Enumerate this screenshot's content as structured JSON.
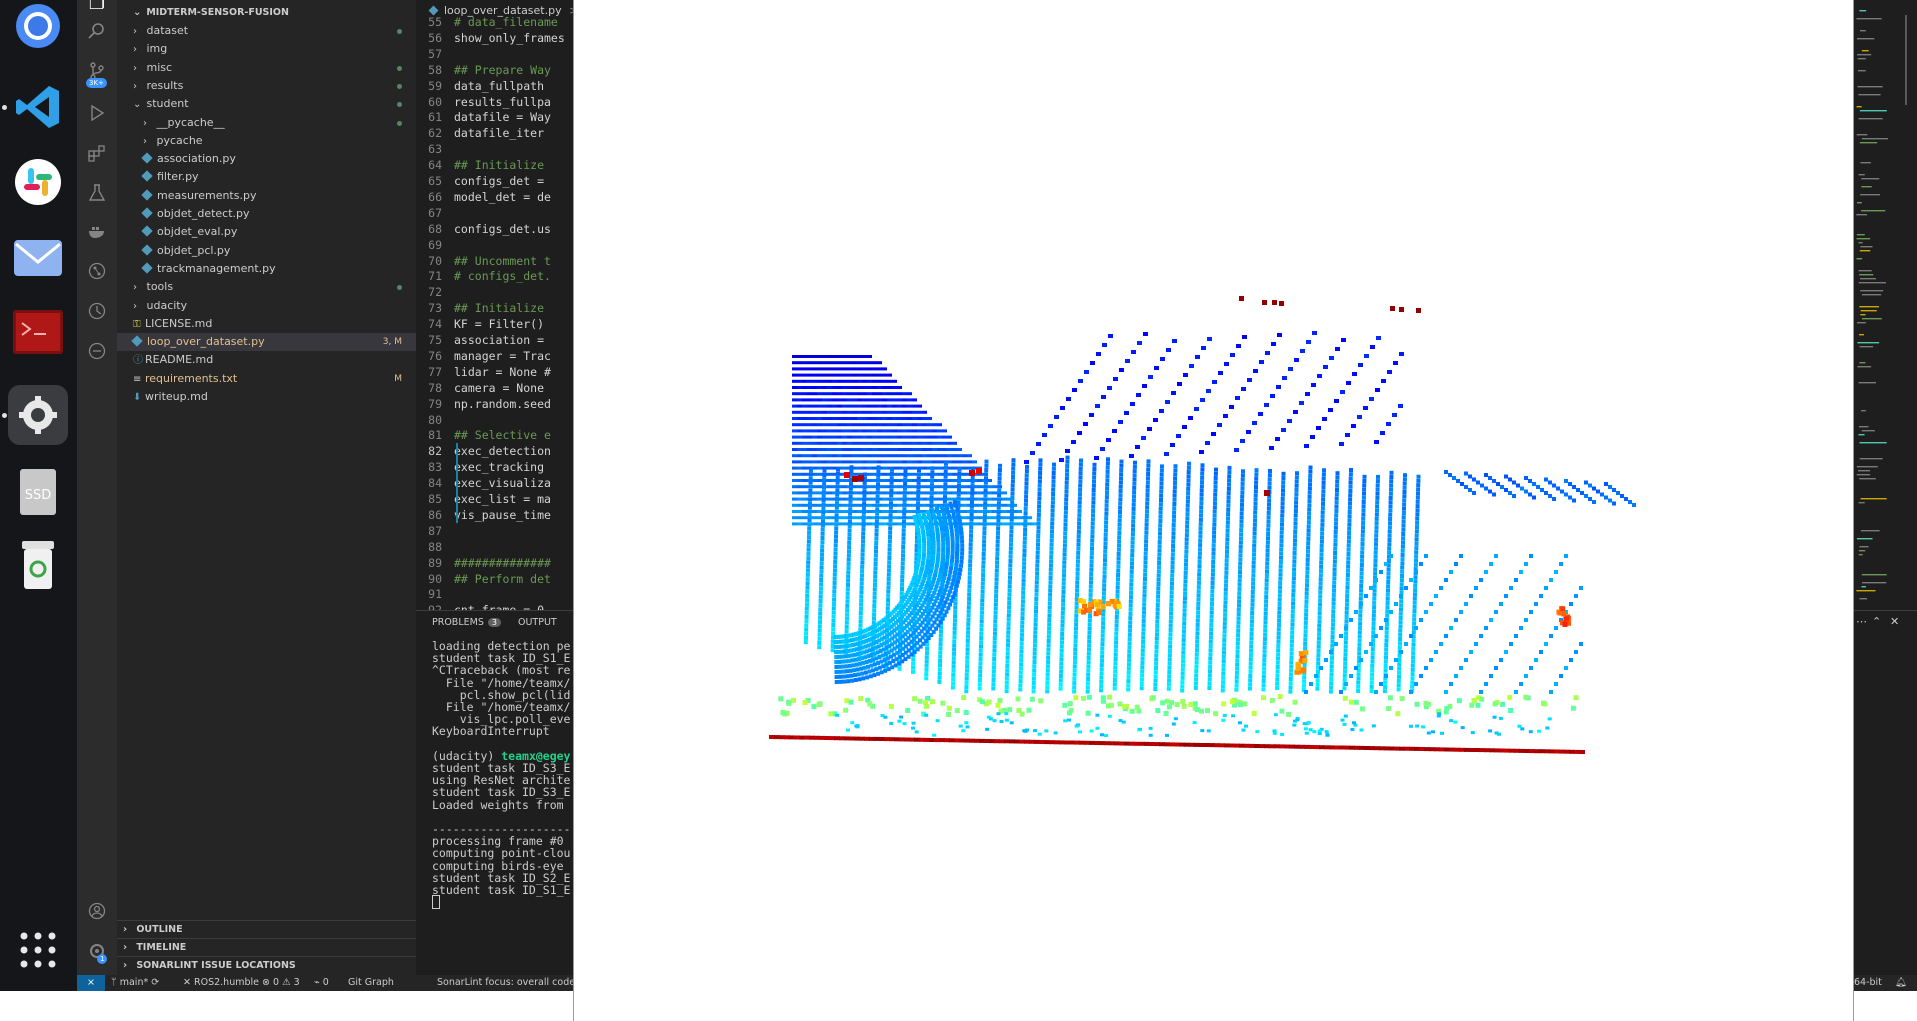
{
  "colors": {
    "dock_bg": "#15161a",
    "activity_bg": "#2c2c2c",
    "explorer_bg": "#252526",
    "editor_bg": "#1e1e1e",
    "accent": "#0e639c",
    "modified": "#e2c08d"
  },
  "dock": {
    "apps": [
      {
        "name": "chromium",
        "icon": "chromium-icon"
      },
      {
        "name": "vscode",
        "icon": "vscode-icon"
      },
      {
        "name": "slack",
        "icon": "slack-icon"
      },
      {
        "name": "mail",
        "icon": "mail-icon"
      },
      {
        "name": "terminal-app",
        "icon": "terminal-icon"
      },
      {
        "name": "settings",
        "icon": "gear-icon"
      },
      {
        "name": "disk",
        "icon": "ssd-icon",
        "label": "SSD"
      },
      {
        "name": "trash",
        "icon": "trash-icon"
      },
      {
        "name": "app-grid",
        "icon": "grid-icon"
      }
    ]
  },
  "activity_bar": {
    "scm_badge": "3K+",
    "accounts_badge": "1"
  },
  "explorer": {
    "root": "MIDTERM-SENSOR-FUSION",
    "items": [
      {
        "label": "dataset",
        "type": "folder",
        "depth": 1,
        "expanded": false,
        "modified": true
      },
      {
        "label": "img",
        "type": "folder",
        "depth": 1,
        "expanded": false,
        "modified": false
      },
      {
        "label": "misc",
        "type": "folder",
        "depth": 1,
        "expanded": false,
        "modified": true
      },
      {
        "label": "results",
        "type": "folder",
        "depth": 1,
        "expanded": false,
        "modified": true
      },
      {
        "label": "student",
        "type": "folder",
        "depth": 1,
        "expanded": true,
        "modified": true
      },
      {
        "label": "__pycache__",
        "type": "folder",
        "depth": 2,
        "expanded": false,
        "modified": true
      },
      {
        "label": "pycache",
        "type": "folder",
        "depth": 2,
        "expanded": false,
        "modified": false
      },
      {
        "label": "association.py",
        "type": "py",
        "depth": 2
      },
      {
        "label": "filter.py",
        "type": "py",
        "depth": 2
      },
      {
        "label": "measurements.py",
        "type": "py",
        "depth": 2
      },
      {
        "label": "objdet_detect.py",
        "type": "py",
        "depth": 2
      },
      {
        "label": "objdet_eval.py",
        "type": "py",
        "depth": 2
      },
      {
        "label": "objdet_pcl.py",
        "type": "py",
        "depth": 2
      },
      {
        "label": "trackmanagement.py",
        "type": "py",
        "depth": 2
      },
      {
        "label": "tools",
        "type": "folder",
        "depth": 1,
        "expanded": false,
        "modified": true
      },
      {
        "label": "udacity",
        "type": "folder",
        "depth": 1,
        "expanded": false,
        "modified": false
      },
      {
        "label": "LICENSE.md",
        "type": "license",
        "depth": 1
      },
      {
        "label": "loop_over_dataset.py",
        "type": "py",
        "depth": 1,
        "selected": true,
        "badge": "3, M"
      },
      {
        "label": "README.md",
        "type": "info",
        "depth": 1
      },
      {
        "label": "requirements.txt",
        "type": "txt",
        "depth": 1,
        "badge": "M"
      },
      {
        "label": "writeup.md",
        "type": "md",
        "depth": 1
      }
    ],
    "sections": [
      "OUTLINE",
      "TIMELINE",
      "SONARLINT ISSUE LOCATIONS"
    ]
  },
  "editor": {
    "tab_label": "loop_over_dataset.py",
    "breadcrumb_sep": ">",
    "current_line": 82,
    "lines": [
      {
        "n": 55,
        "text": "# data_filename",
        "kind": "comment"
      },
      {
        "n": 56,
        "text": "show_only_frames",
        "kind": "code"
      },
      {
        "n": 57,
        "text": "",
        "kind": "code"
      },
      {
        "n": 58,
        "text": "## Prepare Way",
        "kind": "comment"
      },
      {
        "n": 59,
        "text": "data_fullpath",
        "kind": "code"
      },
      {
        "n": 60,
        "text": "results_fullpa",
        "kind": "code"
      },
      {
        "n": 61,
        "text": "datafile = Way",
        "kind": "code"
      },
      {
        "n": 62,
        "text": "datafile_iter",
        "kind": "code"
      },
      {
        "n": 63,
        "text": "",
        "kind": "code"
      },
      {
        "n": 64,
        "text": "## Initialize",
        "kind": "comment"
      },
      {
        "n": 65,
        "text": "configs_det =",
        "kind": "code"
      },
      {
        "n": 66,
        "text": "model_det = de",
        "kind": "code"
      },
      {
        "n": 67,
        "text": "",
        "kind": "code"
      },
      {
        "n": 68,
        "text": "configs_det.us",
        "kind": "code"
      },
      {
        "n": 69,
        "text": "",
        "kind": "code"
      },
      {
        "n": 70,
        "text": "## Uncomment t",
        "kind": "comment"
      },
      {
        "n": 71,
        "text": "# configs_det.",
        "kind": "comment"
      },
      {
        "n": 72,
        "text": "",
        "kind": "code"
      },
      {
        "n": 73,
        "text": "## Initialize",
        "kind": "comment"
      },
      {
        "n": 74,
        "text": "KF = Filter()",
        "kind": "code"
      },
      {
        "n": 75,
        "text": "association =",
        "kind": "code"
      },
      {
        "n": 76,
        "text": "manager = Trac",
        "kind": "code"
      },
      {
        "n": 77,
        "text": "lidar = None #",
        "kind": "code"
      },
      {
        "n": 78,
        "text": "camera = None",
        "kind": "code"
      },
      {
        "n": 79,
        "text": "np.random.seed",
        "kind": "code"
      },
      {
        "n": 80,
        "text": "",
        "kind": "code"
      },
      {
        "n": 81,
        "text": "## Selective e",
        "kind": "comment"
      },
      {
        "n": 82,
        "text": "exec_detection",
        "kind": "code"
      },
      {
        "n": 83,
        "text": "exec_tracking",
        "kind": "code"
      },
      {
        "n": 84,
        "text": "exec_visualiza",
        "kind": "code"
      },
      {
        "n": 85,
        "text": "exec_list = ma",
        "kind": "code"
      },
      {
        "n": 86,
        "text": "vis_pause_time",
        "kind": "code"
      },
      {
        "n": 87,
        "text": "",
        "kind": "code"
      },
      {
        "n": 88,
        "text": "",
        "kind": "code"
      },
      {
        "n": 89,
        "text": "##############",
        "kind": "comment"
      },
      {
        "n": 90,
        "text": "## Perform det",
        "kind": "comment"
      },
      {
        "n": 91,
        "text": "",
        "kind": "code"
      },
      {
        "n": 92,
        "text": "cnt_frame = 0",
        "kind": "code"
      }
    ]
  },
  "panel": {
    "tabs": [
      {
        "label": "PROBLEMS",
        "badge": "3"
      },
      {
        "label": "OUTPUT",
        "badge": ""
      }
    ],
    "terminal_lines": [
      "loading detection pe",
      "student task ID_S1_E",
      "^CTraceback (most re",
      "  File \"/home/teamx/",
      "    pcl.show_pcl(lid",
      "  File \"/home/teamx/",
      "    vis_lpc.poll_eve",
      "KeyboardInterrupt",
      "",
      "",
      "student task ID_S3_E",
      "using ResNet archite",
      "student task ID_S3_E",
      "Loaded weights from",
      "",
      "--------------------",
      "processing frame #0",
      "computing point-clou",
      "computing birds-eye",
      "student task ID_S2_E",
      "student task ID_S1_E"
    ],
    "prompt_env": "(udacity)",
    "prompt_user": "teamx@egey"
  },
  "statusbar": {
    "branch": "main*",
    "ros": "ROS2.humble",
    "errors": "0",
    "warnings": "3",
    "ports": "0",
    "git_graph": "Git Graph",
    "sonarlint": "SonarLint focus: overall code",
    "arch": "64-bit"
  },
  "pointcloud": {
    "window_title": "",
    "colormap": "jet",
    "background": "#ffffff"
  }
}
